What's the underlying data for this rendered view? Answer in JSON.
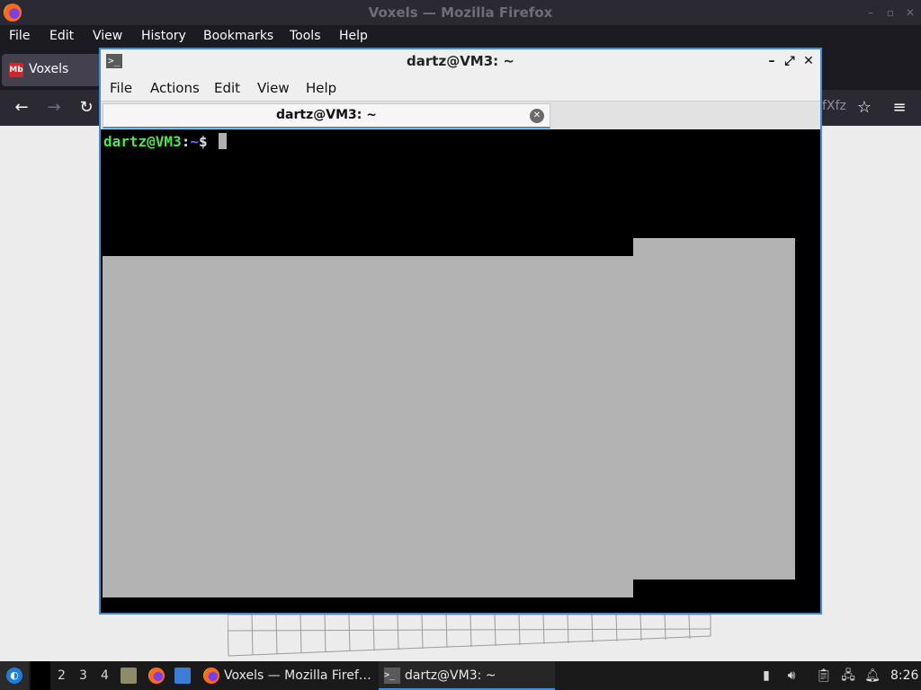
{
  "firefox": {
    "title": "Voxels — Mozilla Firefox",
    "menus": [
      "File",
      "Edit",
      "View",
      "History",
      "Bookmarks",
      "Tools",
      "Help"
    ],
    "tab_label": "Voxels",
    "tab_favicon_text": "Mb",
    "url_fragment": "fXfz",
    "window_controls": [
      "minimize-icon",
      "maximize-icon",
      "close-icon"
    ]
  },
  "terminal": {
    "title": "dartz@VM3: ~",
    "menus": [
      "File",
      "Actions",
      "Edit",
      "View",
      "Help"
    ],
    "tab_label": "dartz@VM3: ~",
    "prompt_user": "dartz@VM3",
    "prompt_sep": ":",
    "prompt_path": "~",
    "prompt_symbol": "$",
    "window_controls": [
      "minimize-icon",
      "restore-icon",
      "close-icon"
    ]
  },
  "taskbar": {
    "workspaces": [
      "2",
      "3",
      "4"
    ],
    "tasks": [
      {
        "label": "Voxels — Mozilla Firef…",
        "icon": "firefox-icon"
      },
      {
        "label": "dartz@VM3: ~",
        "icon": "terminal-icon"
      }
    ],
    "clock": "8:26",
    "tray_icons": [
      "battery-icon",
      "volume-icon",
      "clipboard-icon",
      "network-icon",
      "notification-icon"
    ]
  },
  "colors": {
    "accent": "#3c8ddc",
    "prompt_user": "#4ce64c",
    "prompt_path": "#6a6aff"
  }
}
